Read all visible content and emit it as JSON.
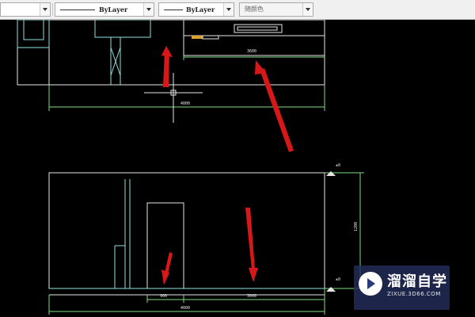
{
  "toolbar": {
    "linetype_value": "ByLayer",
    "lineweight_value": "ByLayer",
    "color_value": "随颜色"
  },
  "drawing": {
    "upper_dim_inner": "3600",
    "upper_dim_total": "4000",
    "lower_dim_left": "900",
    "lower_dim_right": "3000",
    "lower_dim_total": "4000",
    "lower_dim_height": "1200",
    "elevation_top": "±0",
    "elevation_bottom": "±0",
    "colors": {
      "line_white": "#e6e6e6",
      "line_cyan": "#8fe0e0",
      "line_green": "#7fdc7f",
      "arrow_red": "#d81818",
      "accent_orange": "#e0a030"
    }
  },
  "watermark": {
    "title": "溜溜自学",
    "url": "ZIXUE.3D66.COM"
  }
}
